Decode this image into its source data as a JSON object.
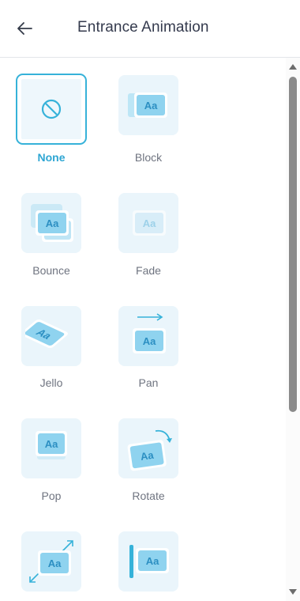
{
  "header": {
    "title": "Entrance Animation",
    "back_icon": "arrow-left-icon"
  },
  "animations": [
    {
      "label": "None",
      "icon": "none-icon",
      "selected": true
    },
    {
      "label": "Block",
      "icon": "block-icon",
      "selected": false
    },
    {
      "label": "Bounce",
      "icon": "bounce-icon",
      "selected": false
    },
    {
      "label": "Fade",
      "icon": "fade-icon",
      "selected": false
    },
    {
      "label": "Jello",
      "icon": "jello-icon",
      "selected": false
    },
    {
      "label": "Pan",
      "icon": "pan-icon",
      "selected": false
    },
    {
      "label": "Pop",
      "icon": "pop-icon",
      "selected": false
    },
    {
      "label": "Rotate",
      "icon": "rotate-icon",
      "selected": false
    },
    {
      "label": "",
      "icon": "zoom-icon",
      "selected": false
    },
    {
      "label": "",
      "icon": "wipe-icon",
      "selected": false
    }
  ],
  "icon_text": "Aa",
  "colors": {
    "accent": "#36b2d9",
    "tile_bg": "#eaf5fb",
    "title": "#343a4d",
    "label": "#6f7480"
  }
}
